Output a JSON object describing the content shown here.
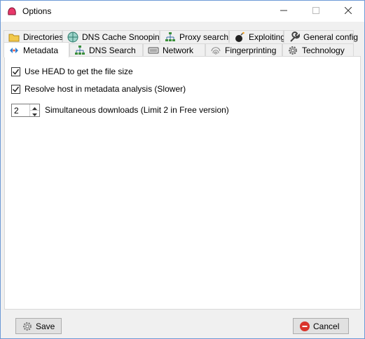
{
  "window": {
    "title": "Options",
    "icon": "app-icon",
    "controls": [
      "minimize-icon",
      "maximize-icon",
      "close-icon"
    ]
  },
  "tabs": {
    "row1": [
      {
        "label": "Directories",
        "icon": "folder-icon"
      },
      {
        "label": "DNS Cache Snooping",
        "icon": "globe-icon"
      },
      {
        "label": "Proxy search",
        "icon": "network-icon"
      },
      {
        "label": "Exploiting",
        "icon": "bomb-icon"
      },
      {
        "label": "General config",
        "icon": "wrench-icon"
      }
    ],
    "row2": [
      {
        "label": "Metadata",
        "icon": "metadata-icon",
        "active": true
      },
      {
        "label": "DNS Search",
        "icon": "network-icon"
      },
      {
        "label": "Network",
        "icon": "keyboard-icon"
      },
      {
        "label": "Fingerprinting",
        "icon": "fingerprint-icon"
      },
      {
        "label": "Technology",
        "icon": "gear-icon"
      }
    ]
  },
  "metadata": {
    "use_head": {
      "label": "Use HEAD to get the file size",
      "checked": true
    },
    "resolve_host": {
      "label": "Resolve host in metadata analysis (Slower)",
      "checked": true
    },
    "downloads": {
      "value": "2",
      "label": "Simultaneous downloads (Limit 2 in Free version)"
    }
  },
  "buttons": {
    "save": {
      "label": "Save",
      "icon": "gear-icon"
    },
    "cancel": {
      "label": "Cancel",
      "icon": "cancel-icon"
    }
  },
  "colors": {
    "accent": "#6d9ad6",
    "app_icon": "#e8386a",
    "cancel_icon": "#d9342b"
  }
}
